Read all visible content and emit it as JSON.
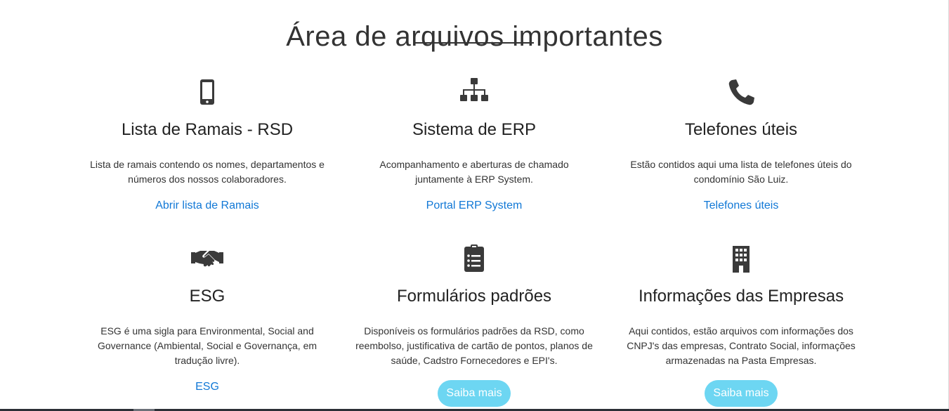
{
  "page": {
    "title": "Área de arquivos importantes"
  },
  "colors": {
    "link": "#1178d6",
    "button_bg": "#6dd6f2",
    "icon": "#3a3a3a"
  },
  "cards": [
    {
      "icon": "mobile-phone-icon",
      "title": "Lista de Ramais - RSD",
      "description": "Lista de ramais contendo os nomes, departamentos e números dos nossos colaboradores.",
      "link_label": "Abrir lista de Ramais"
    },
    {
      "icon": "sitemap-icon",
      "title": "Sistema de ERP",
      "description": "Acompanhamento e aberturas de chamado juntamente à ERP System.",
      "link_label": "Portal ERP System"
    },
    {
      "icon": "phone-icon",
      "title": "Telefones úteis",
      "description": "Estão contidos aqui uma lista de telefones úteis do condomínio São Luiz.",
      "link_label": "Telefones úteis"
    },
    {
      "icon": "handshake-icon",
      "title": "ESG",
      "description": "ESG é uma sigla para Environmental, Social and Governance (Ambiental, Social e Governança, em tradução livre).",
      "link_label": "ESG"
    },
    {
      "icon": "clipboard-list-icon",
      "title": "Formulários padrões",
      "description": "Disponíveis os formulários padrões da RSD, como reembolso, justificativa de cartão de pontos, planos de saúde, Cadstro Fornecedores e EPI's.",
      "button_label": "Saiba mais"
    },
    {
      "icon": "building-icon",
      "title": "Informações das Empresas",
      "description": "Aqui contidos, estão arquivos com informações dos CNPJ's das empresas, Contrato Social, informações armazenadas na Pasta Empresas.",
      "button_label": "Saiba mais"
    }
  ]
}
